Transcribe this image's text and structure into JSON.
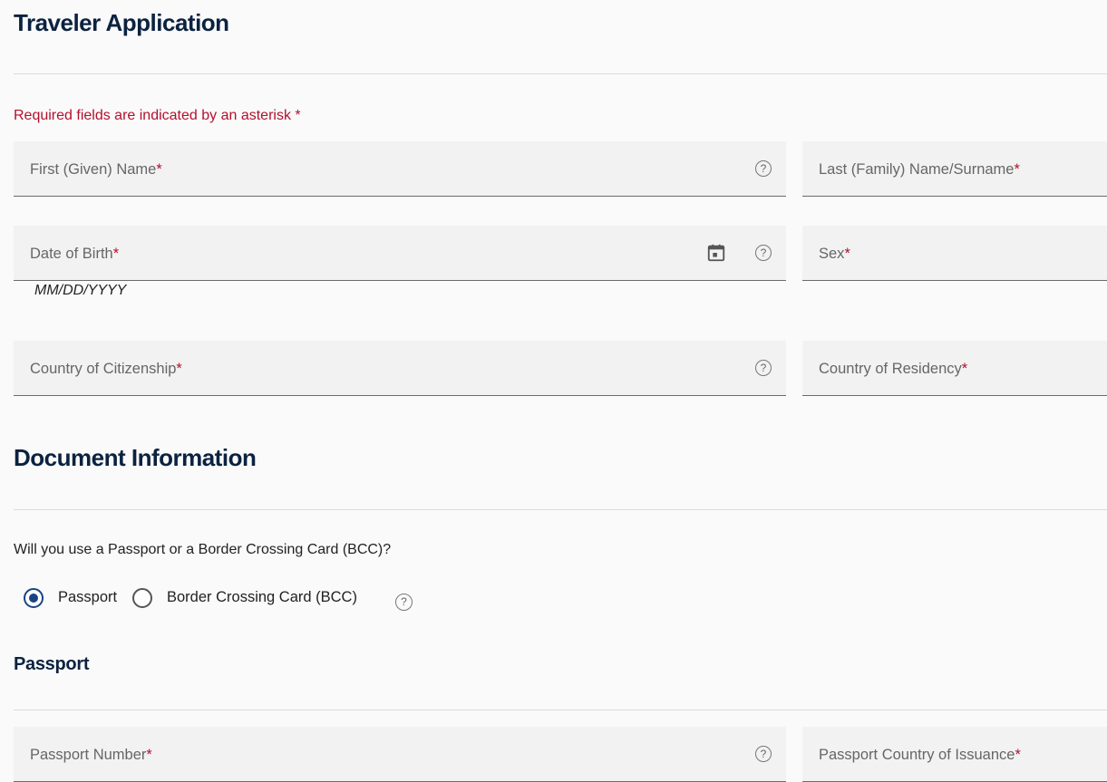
{
  "page": {
    "title": "Traveler Application",
    "required_note": "Required fields are indicated by an asterisk *"
  },
  "fields": {
    "first_name": {
      "label": "First (Given) Name",
      "star": "*"
    },
    "last_name": {
      "label": "Last (Family) Name/Surname",
      "star": "*"
    },
    "dob": {
      "label": "Date of Birth",
      "star": "*",
      "hint": "MM/DD/YYYY"
    },
    "sex": {
      "label": "Sex",
      "star": "*"
    },
    "citizenship": {
      "label": "Country of Citizenship",
      "star": "*"
    },
    "residency": {
      "label": "Country of Residency",
      "star": "*"
    }
  },
  "document": {
    "title": "Document Information",
    "question": "Will you use a Passport or a Border Crossing Card (BCC)?",
    "options": [
      {
        "label": "Passport",
        "selected": true
      },
      {
        "label": "Border Crossing Card (BCC)",
        "selected": false
      }
    ],
    "passport_title": "Passport",
    "passport_number": {
      "label": "Passport Number",
      "star": "*"
    },
    "passport_country": {
      "label": "Passport Country of Issuance",
      "star": "*"
    }
  },
  "icons": {
    "help": "question-circle-icon",
    "calendar": "calendar-icon",
    "help_glyph": "?"
  },
  "colors": {
    "heading": "#0b2240",
    "required": "#b3102e",
    "radio_selected": "#1a4480"
  }
}
